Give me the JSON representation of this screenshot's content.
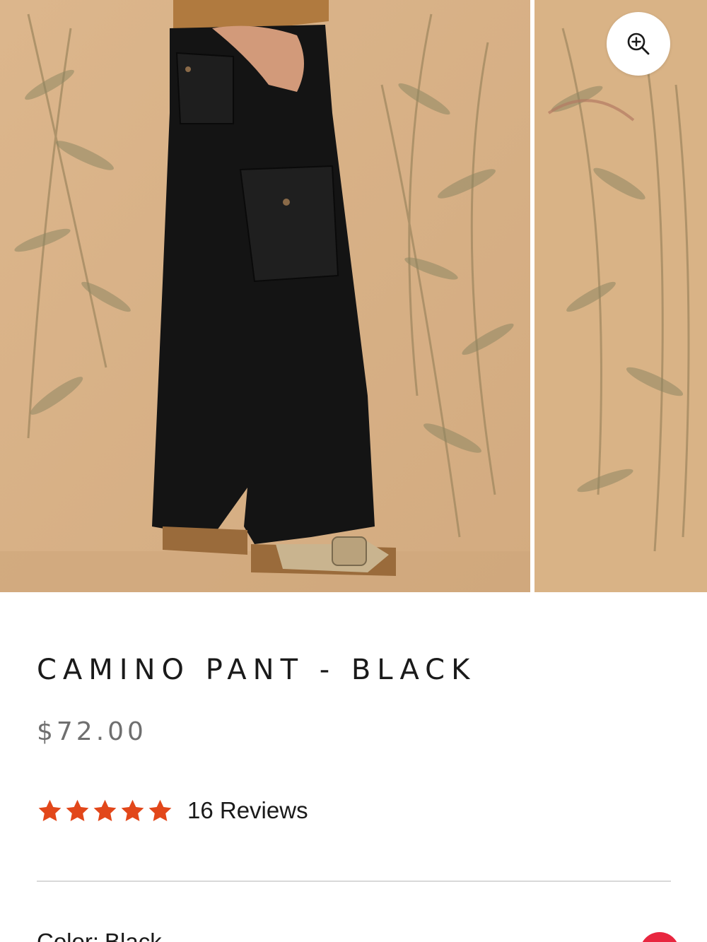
{
  "gallery": {
    "zoom_icon": "zoom-in-icon",
    "image_alt": "Camino Pant - Black worn with cork sandals"
  },
  "product": {
    "title": "CAMINO PANT - BLACK",
    "price": "$72.00",
    "rating": {
      "stars": 5,
      "max": 5,
      "star_color": "#e2471a",
      "reviews_label": "16 Reviews"
    }
  },
  "options": {
    "color_label": "Color:",
    "color_value": "Black"
  },
  "colors": {
    "accent": "#e8263f",
    "price_text": "#6f6f6f",
    "backdrop": "#d9b48b"
  }
}
